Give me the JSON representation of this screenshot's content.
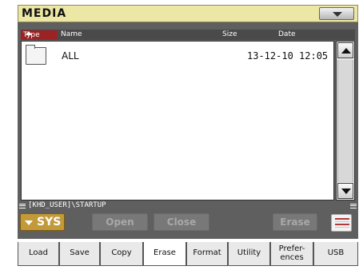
{
  "window": {
    "title": "MEDIA"
  },
  "file_list": {
    "columns": {
      "type": "Type",
      "name": "Name",
      "size": "Size",
      "date": "Date"
    },
    "rows": [
      {
        "name": "ALL",
        "size": "",
        "date": "13-12-10 12:05",
        "icon": "folder-icon"
      }
    ]
  },
  "path": "[KHD_USER]\\STARTUP",
  "actions": {
    "device": "SYS",
    "open": "Open",
    "close": "Close",
    "erase": "Erase"
  },
  "tabs": [
    {
      "label": "Load",
      "active": false
    },
    {
      "label": "Save",
      "active": false
    },
    {
      "label": "Copy",
      "active": false
    },
    {
      "label": "Erase",
      "active": true
    },
    {
      "label": "Format",
      "active": false
    },
    {
      "label": "Utility",
      "active": false
    },
    {
      "label": "Prefer-",
      "label2": "ences",
      "active": false
    },
    {
      "label": "USB",
      "active": false
    }
  ],
  "colors": {
    "title_bg": "#ede7a6",
    "panel_bg": "#5f5f5f",
    "sort_column": "#9b2323",
    "device_button": "#c29a3a"
  }
}
